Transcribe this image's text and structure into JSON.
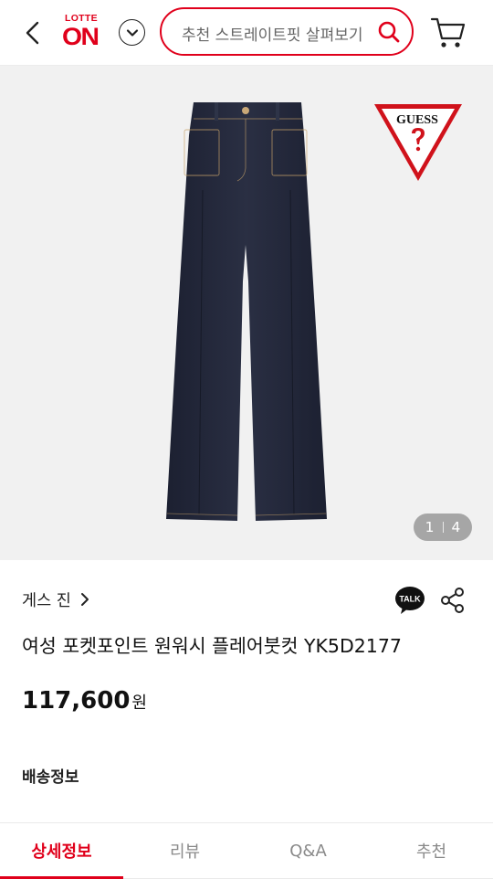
{
  "header": {
    "logo_top": "LOTTE",
    "logo_main": "ON",
    "search_placeholder": "추천 스트레이트핏 살펴보기"
  },
  "gallery": {
    "current_page": "1",
    "total_pages": "4",
    "brand_mark": "GUESS"
  },
  "product": {
    "brand": "게스 진",
    "title": "여성 포켓포인트 원워시 플레어붓컷 YK5D2177",
    "price": "117,600",
    "currency": "원",
    "shipping_label": "배송정보",
    "talk_label": "TALK"
  },
  "tabs": [
    {
      "label": "상세정보",
      "active": true
    },
    {
      "label": "리뷰",
      "active": false
    },
    {
      "label": "Q&A",
      "active": false
    },
    {
      "label": "추천",
      "active": false
    }
  ],
  "colors": {
    "accent": "#e0001b",
    "denim": "#23283a",
    "background": "#f1f1f1"
  },
  "icons": [
    "back-arrow-icon",
    "chevron-down-icon",
    "search-icon",
    "cart-icon",
    "chevron-right-icon",
    "kakao-talk-icon",
    "share-icon"
  ]
}
